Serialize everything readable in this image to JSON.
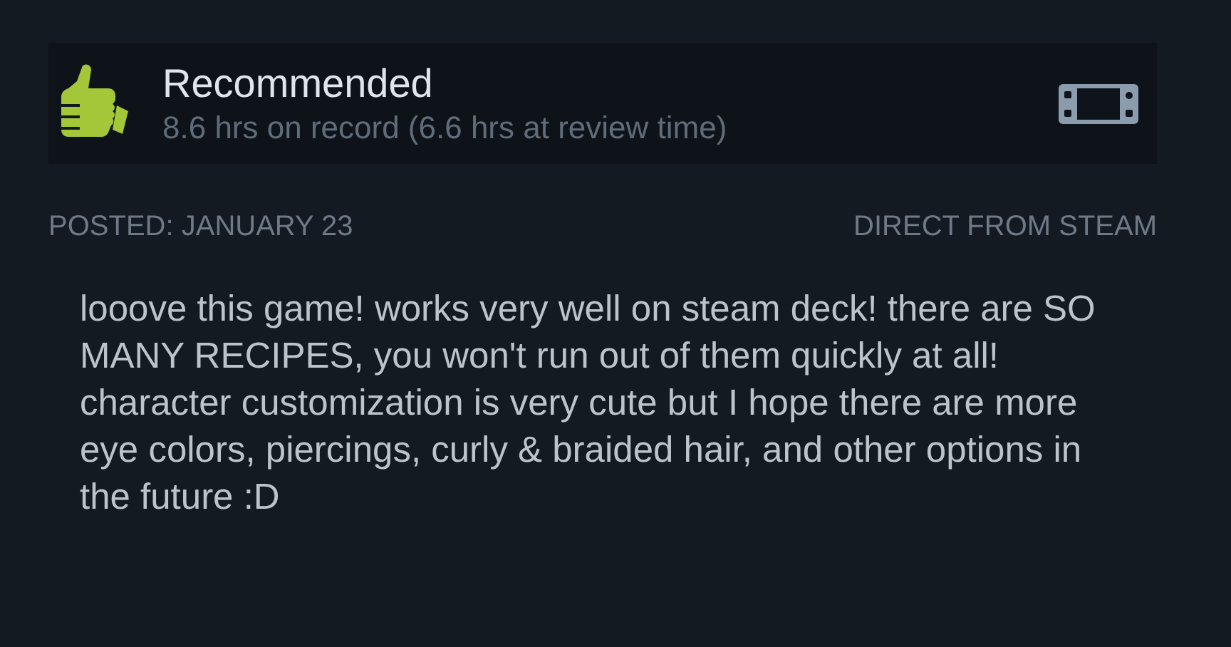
{
  "review": {
    "recommended": true,
    "verdict": "Recommended",
    "playtime": "8.6 hrs on record (6.6 hrs at review time)",
    "played_on_deck": true
  },
  "posted": "POSTED: JANUARY 23",
  "source": "DIRECT FROM STEAM",
  "body": "looove this game! works very well on steam deck! there are SO MANY RECIPES, you won't run out of them quickly at all! character customization is very cute but I hope there are more eye colors, piercings, curly & braided hair, and other options in the future :D"
}
